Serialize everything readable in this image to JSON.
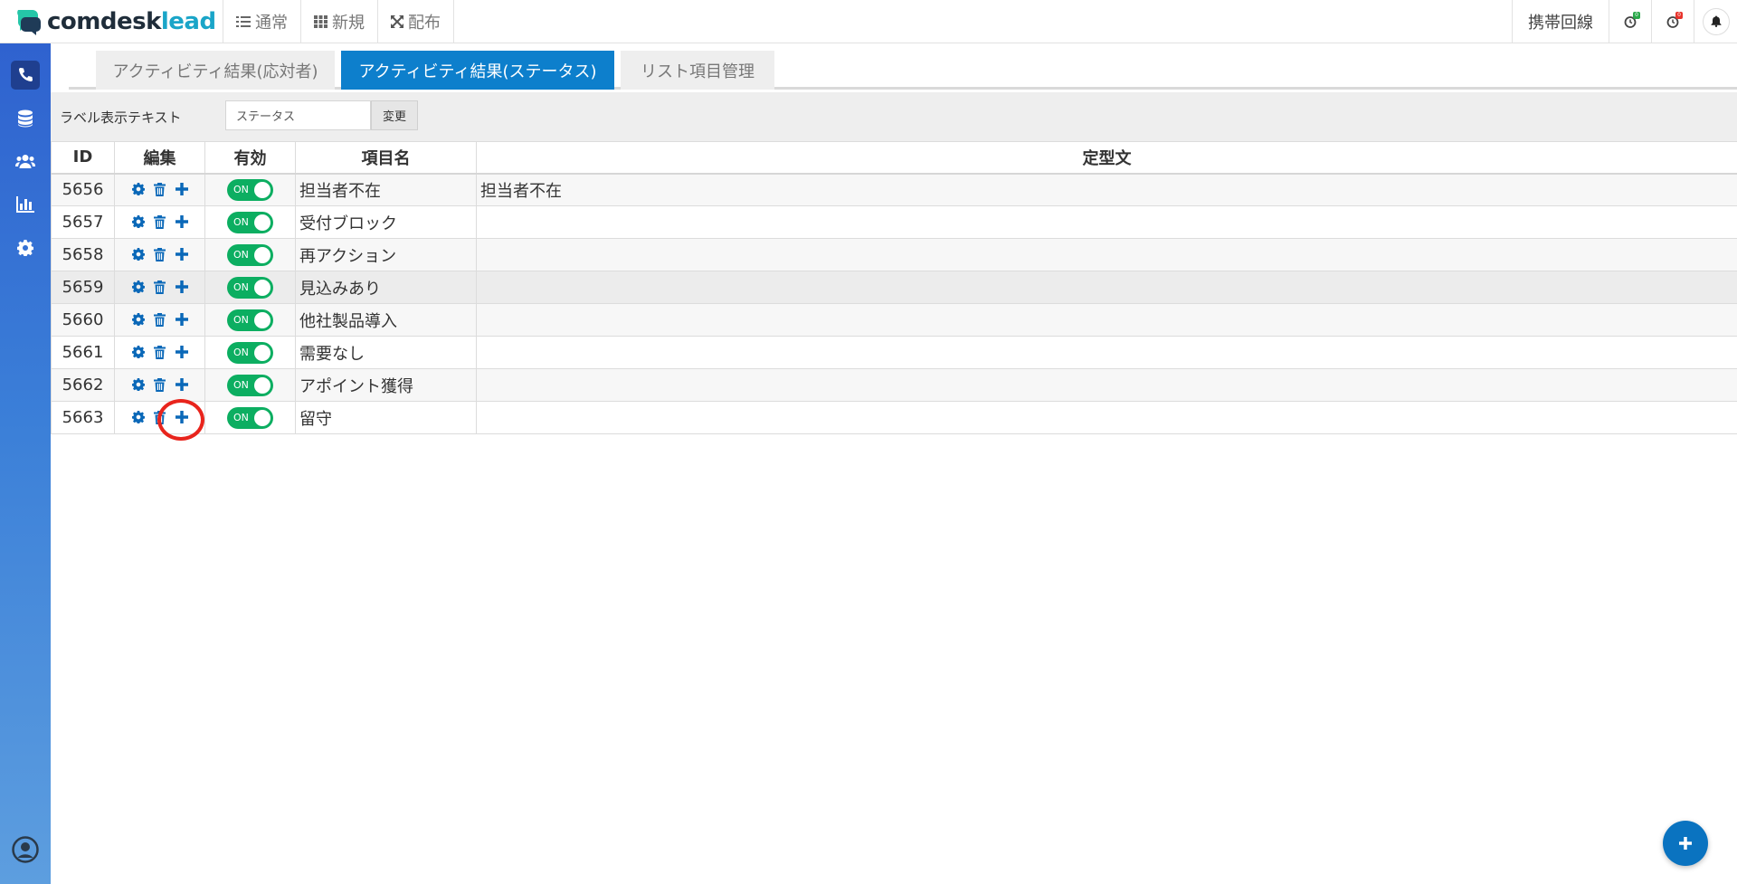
{
  "app": {
    "logo_main": "comdesk",
    "logo_accent": "lead"
  },
  "nav": [
    {
      "label": "通常",
      "icon": "list-icon"
    },
    {
      "label": "新規",
      "icon": "grid-icon"
    },
    {
      "label": "配布",
      "icon": "expand-icon"
    }
  ],
  "topbar": {
    "mobile_line": "携帯回線",
    "badge_green": "0",
    "badge_red": "0"
  },
  "sidebar": [
    "phone-icon",
    "database-icon",
    "users-icon",
    "bar-chart-icon",
    "gear-icon"
  ],
  "tabs": [
    {
      "label": "アクティビティ結果(応対者)",
      "active": false
    },
    {
      "label": "アクティビティ結果(ステータス)",
      "active": true
    },
    {
      "label": "リスト項目管理",
      "active": false
    }
  ],
  "label_bar": {
    "label": "ラベル表示テキスト",
    "input_value": "ステータス",
    "button": "変更"
  },
  "table": {
    "headers": {
      "id": "ID",
      "edit": "編集",
      "enabled": "有効",
      "name": "項目名",
      "template": "定型文"
    },
    "toggle_label": "ON",
    "rows": [
      {
        "id": "5656",
        "name": "担当者不在",
        "template": "担当者不在"
      },
      {
        "id": "5657",
        "name": "受付ブロック",
        "template": ""
      },
      {
        "id": "5658",
        "name": "再アクション",
        "template": ""
      },
      {
        "id": "5659",
        "name": "見込みあり",
        "template": ""
      },
      {
        "id": "5660",
        "name": "他社製品導入",
        "template": ""
      },
      {
        "id": "5661",
        "name": "需要なし",
        "template": ""
      },
      {
        "id": "5662",
        "name": "アポイント獲得",
        "template": ""
      },
      {
        "id": "5663",
        "name": "留守",
        "template": ""
      }
    ]
  },
  "colors": {
    "primary": "#0d7fcc",
    "toggle_on": "#0cae61",
    "sidebar": "#2f62cf",
    "highlight": "#e8241c"
  }
}
